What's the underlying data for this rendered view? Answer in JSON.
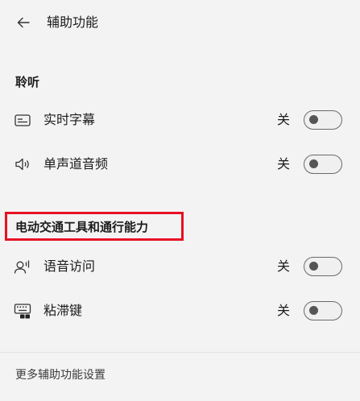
{
  "header": {
    "title": "辅助功能",
    "back_icon": "back-arrow-icon"
  },
  "sections": [
    {
      "title": "聆听",
      "items": [
        {
          "label": "实时字幕",
          "state": "关",
          "icon": "captions-icon",
          "on": false
        },
        {
          "label": "单声道音频",
          "state": "关",
          "icon": "speaker-icon",
          "on": false
        }
      ]
    },
    {
      "title": "电动交通工具和通行能力",
      "items": [
        {
          "label": "语音访问",
          "state": "关",
          "icon": "voice-access-icon",
          "on": false
        },
        {
          "label": "粘滞键",
          "state": "关",
          "icon": "keyboard-icon",
          "on": false
        }
      ]
    }
  ],
  "footer": {
    "link": "更多辅助功能设置"
  },
  "colors": {
    "highlight": "#e81123",
    "background": "#f3f3f3"
  }
}
